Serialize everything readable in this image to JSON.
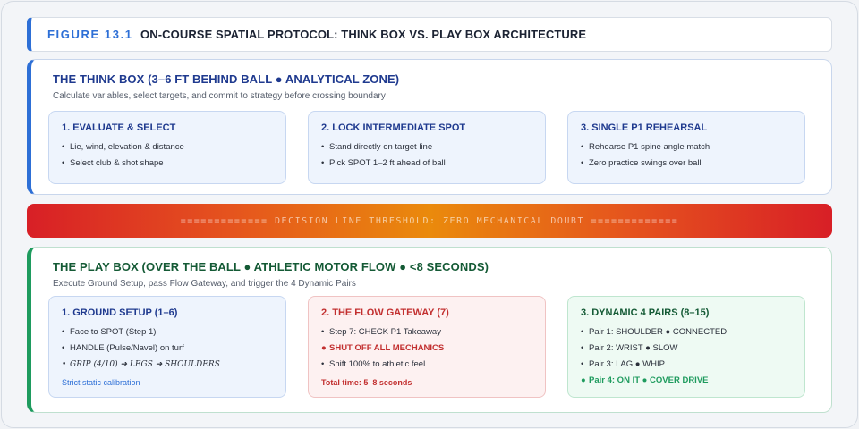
{
  "figure": {
    "number": "FIGURE 13.1",
    "title": "ON-COURSE SPATIAL PROTOCOL: THINK BOX VS. PLAY BOX ARCHITECTURE"
  },
  "think_box": {
    "title": "THE THINK BOX (3–6 FT BEHIND BALL ● ANALYTICAL ZONE)",
    "subtitle": "Calculate variables, select targets, and commit to strategy before crossing boundary",
    "cards": [
      {
        "title": "1. EVALUATE & SELECT",
        "items": [
          "Lie, wind, elevation & distance",
          "Select club & shot shape"
        ]
      },
      {
        "title": "2. LOCK INTERMEDIATE SPOT",
        "items": [
          "Stand directly on target line",
          "Pick SPOT 1–2 ft ahead of ball"
        ]
      },
      {
        "title": "3. SINGLE P1 REHEARSAL",
        "items": [
          "Rehearse P1 spine angle match",
          "Zero practice swings over ball"
        ]
      }
    ]
  },
  "threshold": {
    "text": "============= DECISION LINE THRESHOLD: ZERO MECHANICAL DOUBT ============="
  },
  "play_box": {
    "title": "THE PLAY BOX (OVER THE BALL ● ATHLETIC MOTOR FLOW ● <8 SECONDS)",
    "subtitle": "Execute Ground Setup, pass Flow Gateway, and trigger the 4 Dynamic Pairs",
    "cards": [
      {
        "title": "1. GROUND SETUP (1–6)",
        "items": [
          "Face to SPOT (Step 1)",
          "HANDLE (Pulse/Navel) on turf",
          "GRIP (4/10) ➔ LEGS ➔ SHOULDERS"
        ],
        "note": "Strict static calibration"
      },
      {
        "title": "2. THE FLOW GATEWAY (7)",
        "items": [
          "Step 7: CHECK P1 Takeaway",
          "SHUT OFF ALL MECHANICS",
          "Shift 100% to athletic feel"
        ],
        "note": "Total time: 5–8 seconds"
      },
      {
        "title": "3. DYNAMIC 4 PAIRS (8–15)",
        "items": [
          "Pair 1: SHOULDER ● CONNECTED",
          "Pair 2: WRIST ● SLOW",
          "Pair 3: LAG ● WHIP",
          "Pair 4: ON IT ● COVER DRIVE"
        ]
      }
    ]
  },
  "colors": {
    "think_accent": "#2d6fd6",
    "play_accent": "#1e9b5e",
    "alert_red": "#c22f2f",
    "threshold_center": "#ea8a0c",
    "threshold_edge": "#d81f26"
  }
}
